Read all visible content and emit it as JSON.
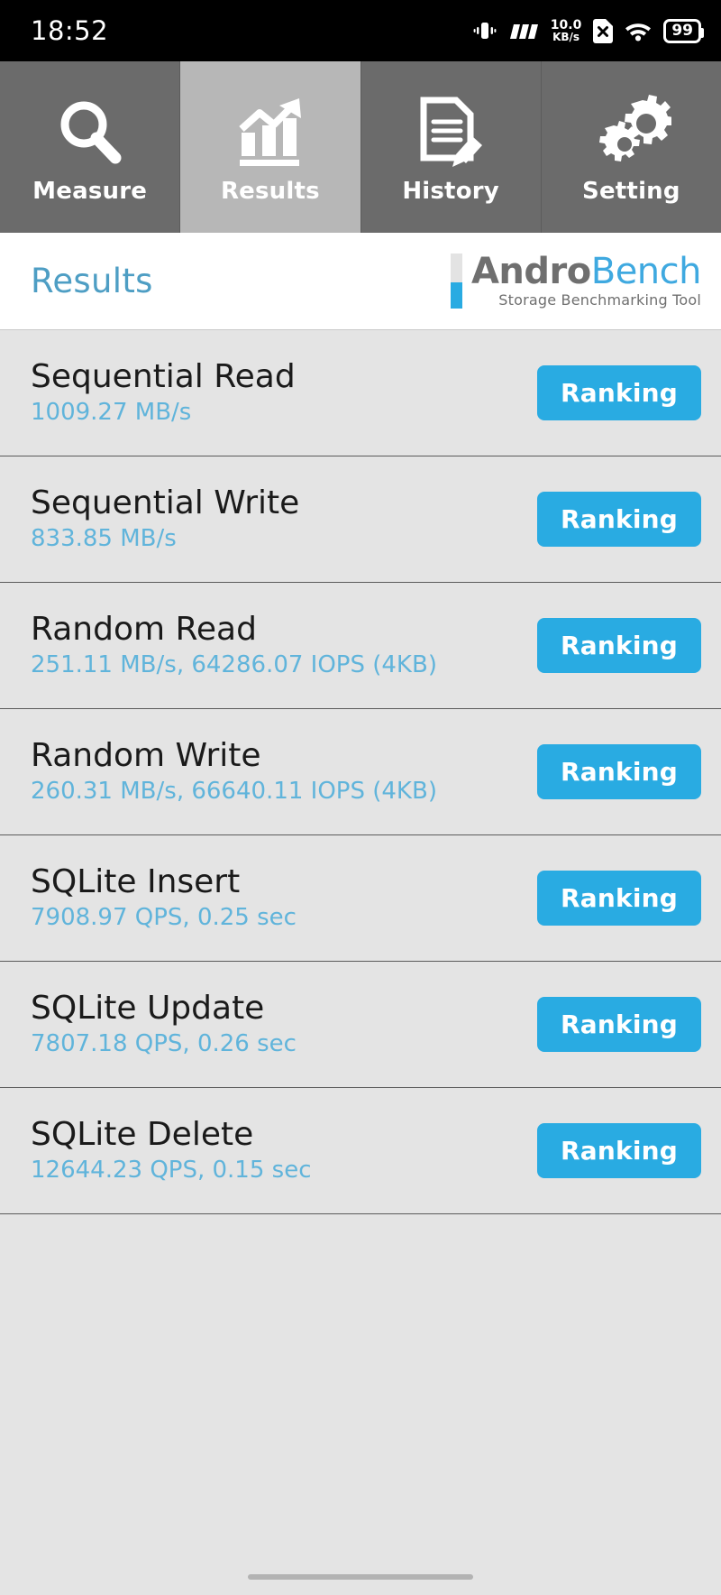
{
  "statusbar": {
    "clock": "18:52",
    "icons": [
      "vibrate-icon",
      "signal-icon",
      "network-speed",
      "sim-disabled-icon",
      "wifi-icon"
    ],
    "network_speed_value": "10.0",
    "network_speed_unit": "KB/s",
    "battery_level": "99"
  },
  "tabs": [
    {
      "label": "Measure",
      "icon": "magnifier-icon",
      "active": false
    },
    {
      "label": "Results",
      "icon": "bar-chart-arrow-icon",
      "active": true
    },
    {
      "label": "History",
      "icon": "document-pencil-icon",
      "active": false
    },
    {
      "label": "Setting",
      "icon": "gears-icon",
      "active": false
    }
  ],
  "header": {
    "title": "Results",
    "logo_primary": "Andro",
    "logo_secondary": "Bench",
    "logo_tagline": "Storage Benchmarking Tool"
  },
  "results": [
    {
      "name": "Sequential Read",
      "value": "1009.27 MB/s",
      "button": "Ranking"
    },
    {
      "name": "Sequential Write",
      "value": "833.85 MB/s",
      "button": "Ranking"
    },
    {
      "name": "Random Read",
      "value": "251.11 MB/s, 64286.07 IOPS (4KB)",
      "button": "Ranking"
    },
    {
      "name": "Random Write",
      "value": "260.31 MB/s, 66640.11 IOPS (4KB)",
      "button": "Ranking"
    },
    {
      "name": "SQLite Insert",
      "value": "7908.97 QPS, 0.25 sec",
      "button": "Ranking"
    },
    {
      "name": "SQLite Update",
      "value": "7807.18 QPS, 0.26 sec",
      "button": "Ranking"
    },
    {
      "name": "SQLite Delete",
      "value": "12644.23 QPS, 0.15 sec",
      "button": "Ranking"
    }
  ],
  "colors": {
    "accent_blue": "#29abe2",
    "value_blue": "#60b4db",
    "title_blue": "#4e9ec4",
    "tab_inactive": "#6b6b6b",
    "tab_active": "#b7b7b7",
    "list_background": "#e4e4e4"
  }
}
